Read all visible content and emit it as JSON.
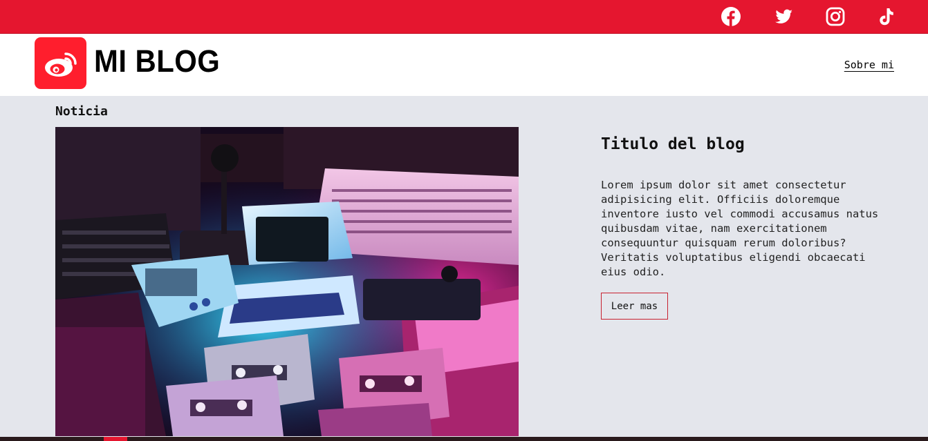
{
  "social": {
    "icons": [
      "facebook-icon",
      "twitter-icon",
      "instagram-icon",
      "tiktok-icon"
    ]
  },
  "header": {
    "brand": "MI BLOG",
    "logo_icon": "weibo-icon",
    "nav_link": "Sobre mi"
  },
  "main": {
    "section_title": "Noticia",
    "post": {
      "title": "Titulo del blog",
      "text": "Lorem ipsum dolor sit amet consectetur adipisicing elit. Officiis doloremque inventore iusto vel commodi accusamus natus quibusdam vitae, nam exercitationem consequuntur quisquam rerum doloribus? Veritatis voluptatibus eligendi obcaecati eius odio.",
      "button": "Leer mas"
    }
  },
  "colors": {
    "brand_red": "#e5162f",
    "logo_red": "#ff1e2d",
    "page_bg": "#e4e6ec",
    "header_bg": "#ffffff"
  }
}
